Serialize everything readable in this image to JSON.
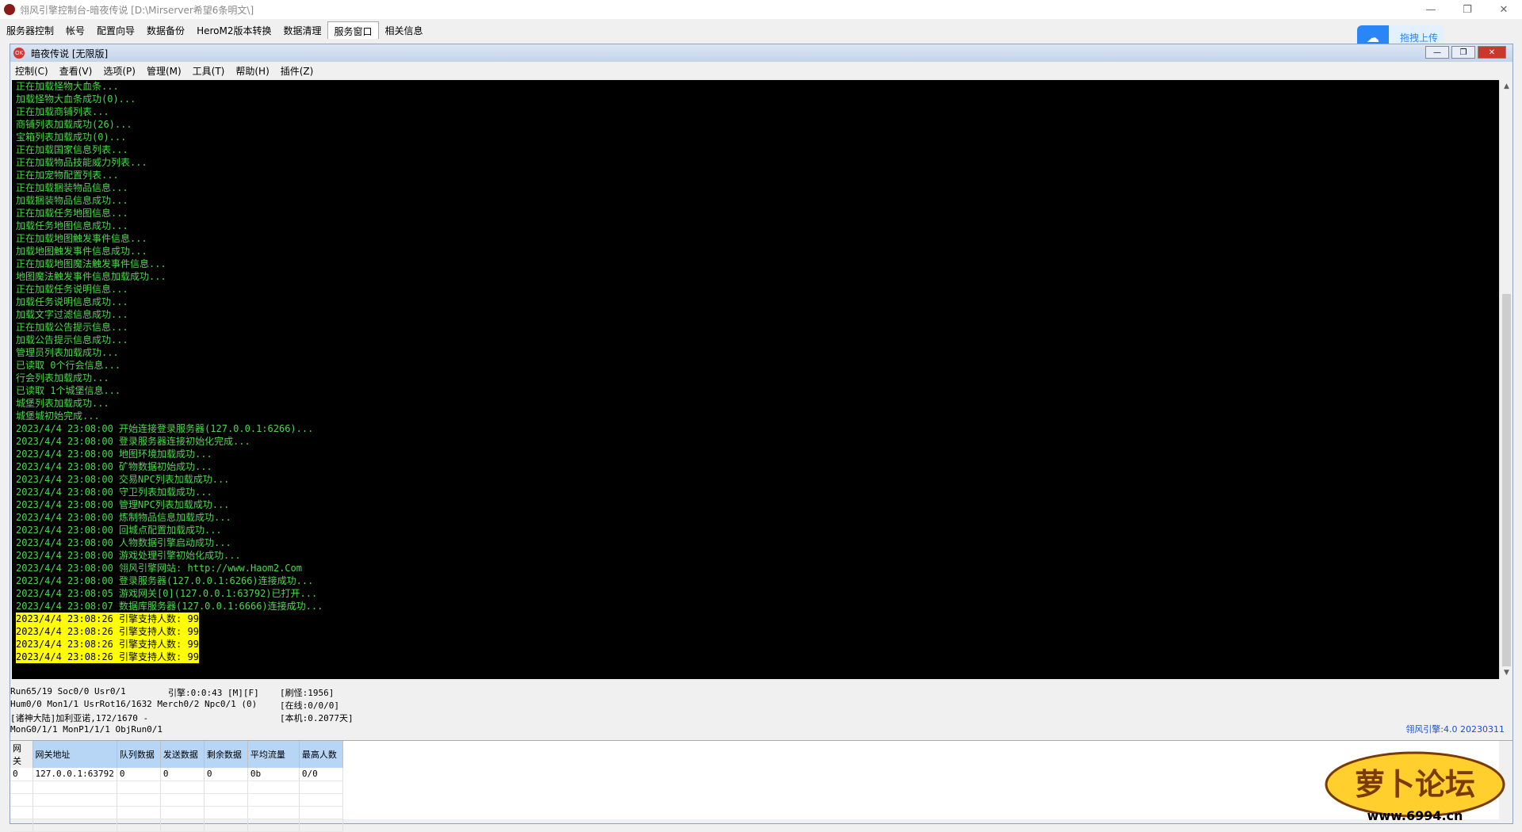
{
  "window": {
    "title": "翎风引擎控制台-暗夜传说 [D:\\Mirserver希望6条明文\\]",
    "minimize": "—",
    "maximize": "❐",
    "close": "✕"
  },
  "tabs": [
    "服务器控制",
    "帐号",
    "配置向导",
    "数据备份",
    "HeroM2版本转换",
    "数据清理",
    "服务窗口",
    "相关信息"
  ],
  "active_tab": "服务窗口",
  "upload_button": {
    "label": "拖拽上传",
    "icon": "cloud-icon"
  },
  "inner_window": {
    "title": "暗夜传说 [无限版]",
    "logo": "OK"
  },
  "menu": [
    "控制(C)",
    "查看(V)",
    "选项(P)",
    "管理(M)",
    "工具(T)",
    "帮助(H)",
    "插件(Z)"
  ],
  "console": {
    "lines": [
      "正在加载怪物大血条...",
      "加载怪物大血条成功(0)...",
      "正在加载商铺列表...",
      "商铺列表加载成功(26)...",
      "宝箱列表加载成功(0)...",
      "正在加载国家信息列表...",
      "正在加载物品技能威力列表...",
      "正在加宠物配置列表...",
      "正在加载捆装物品信息...",
      "加载捆装物品信息成功...",
      "正在加载任务地图信息...",
      "加载任务地图信息成功...",
      "正在加载地图触发事件信息...",
      "加载地图触发事件信息成功...",
      "正在加载地图魔法触发事件信息...",
      "地图魔法触发事件信息加载成功...",
      "正在加载任务说明信息...",
      "加载任务说明信息成功...",
      "加载文字过滤信息成功...",
      "正在加载公告提示信息...",
      "加载公告提示信息成功...",
      "管理员列表加载成功...",
      "已读取 0个行会信息...",
      "行会列表加载成功...",
      "已读取 1个城堡信息...",
      "城堡列表加载成功...",
      "城堡城初始完成...",
      "2023/4/4 23:08:00 开始连接登录服务器(127.0.0.1:6266)...",
      "2023/4/4 23:08:00 登录服务器连接初始化完成...",
      "2023/4/4 23:08:00 地图环境加载成功...",
      "2023/4/4 23:08:00 矿物数据初始成功...",
      "2023/4/4 23:08:00 交易NPC列表加载成功...",
      "2023/4/4 23:08:00 守卫列表加载成功...",
      "2023/4/4 23:08:00 管理NPC列表加载成功...",
      "2023/4/4 23:08:00 炼制物品信息加载成功...",
      "2023/4/4 23:08:00 回城点配置加载成功...",
      "2023/4/4 23:08:00 人物数据引擎启动成功...",
      "2023/4/4 23:08:00 游戏处理引擎初始化成功...",
      "2023/4/4 23:08:00 翎风引擎网站: http://www.Haom2.Com",
      "2023/4/4 23:08:00 登录服务器(127.0.0.1:6266)连接成功...",
      "2023/4/4 23:08:05 游戏网关[0](127.0.0.1:63792)已打开...",
      "2023/4/4 23:08:07 数据库服务器(127.0.0.1:6666)连接成功..."
    ],
    "highlighted_lines": [
      "2023/4/4 23:08:26 引擎支持人数: 99",
      "2023/4/4 23:08:26 引擎支持人数: 99",
      "2023/4/4 23:08:26 引擎支持人数: 99",
      "2023/4/4 23:08:26 引擎支持人数: 99"
    ]
  },
  "status": {
    "run": "Run65/19 Soc0/0 Usr0/1",
    "engine": "引擎:0:0:43 [M][F]",
    "refresh": "[刷怪:1956]",
    "hum": "Hum0/0 Mon1/1 UsrRot16/1632 Merch0/2 Npc0/1 (0)",
    "online": "[在线:0/0/0]",
    "map": "[诸神大陆]加利亚诺,172/1670 -",
    "local": "[本机:0.2077天]",
    "mon": "MonG0/1/1 MonP1/1/1 ObjRun0/1",
    "version": "翎风引擎:4.0 20230311"
  },
  "gateway_table": {
    "columns": [
      "网关",
      "网关地址",
      "队列数据",
      "发送数据",
      "剩余数据",
      "平均流量",
      "最高人数"
    ],
    "rows": [
      [
        "0",
        "127.0.0.1:63792",
        "0",
        "0",
        "0",
        "0b",
        "0/0"
      ]
    ]
  },
  "watermark": {
    "text": "萝卜论坛",
    "url": "www.6994.cn"
  }
}
